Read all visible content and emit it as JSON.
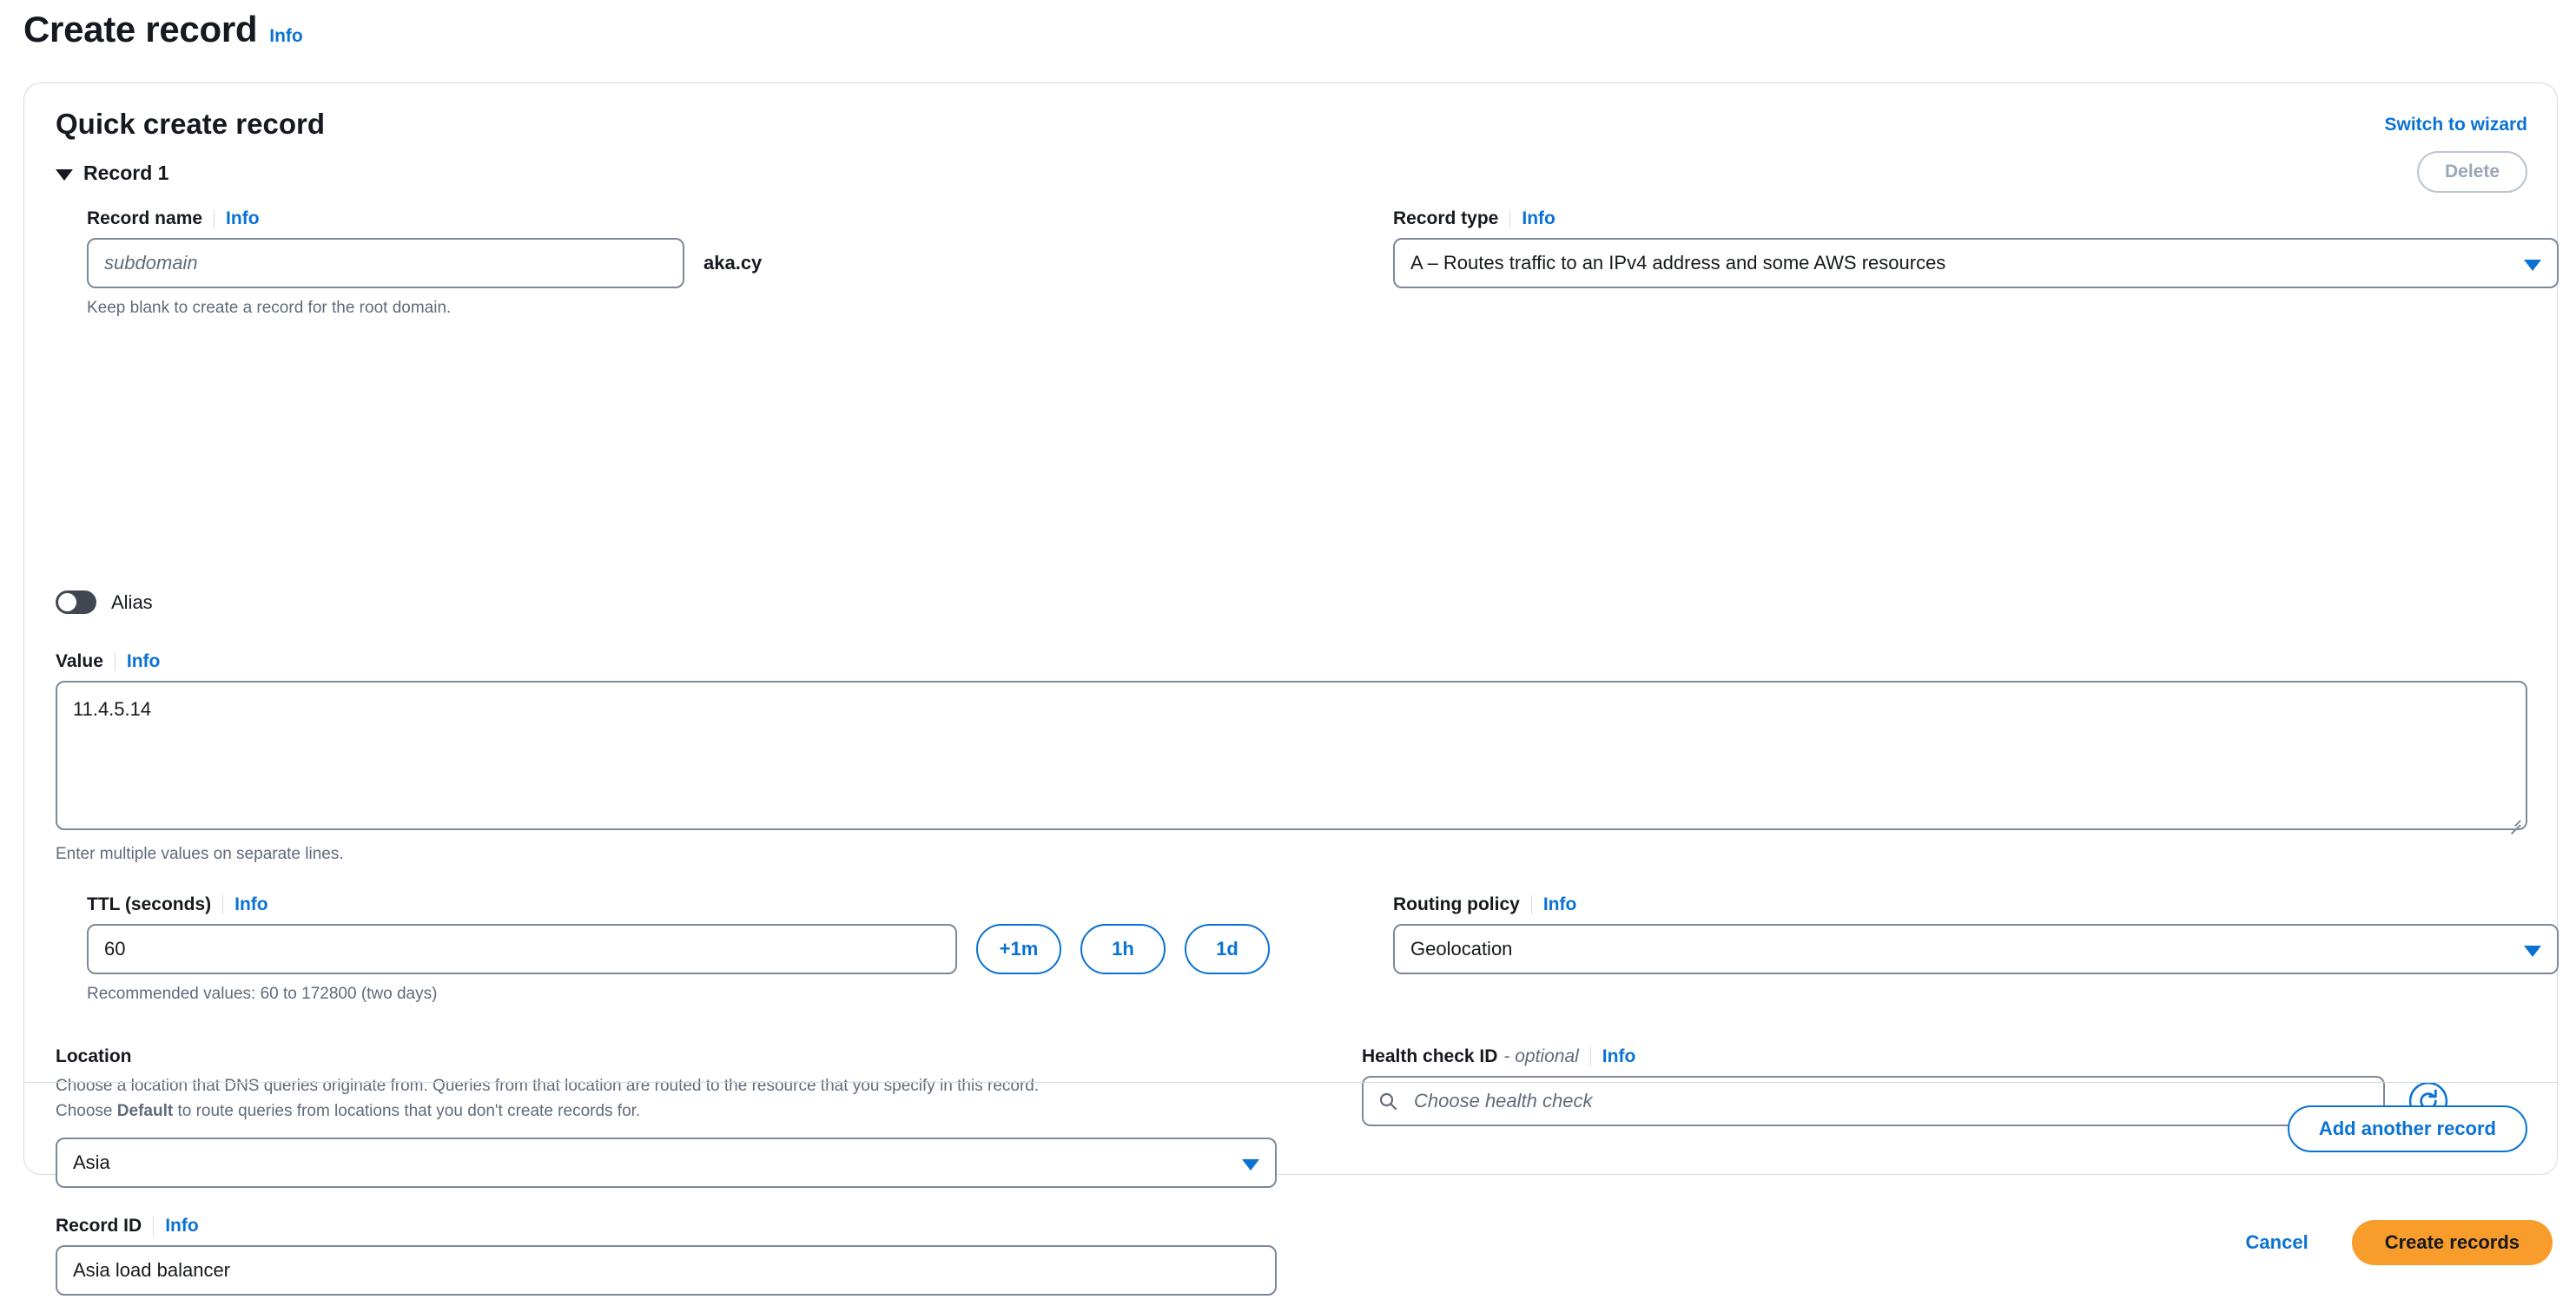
{
  "page": {
    "title": "Create record",
    "info_label": "Info"
  },
  "card": {
    "title": "Quick create record",
    "switch_link": "Switch to wizard",
    "record_label": "Record 1",
    "delete_label": "Delete",
    "add_another_label": "Add another record"
  },
  "fields": {
    "record_name": {
      "label": "Record name",
      "info": "Info",
      "value": "",
      "placeholder": "subdomain",
      "suffix": "aka.cy",
      "hint": "Keep blank to create a record for the root domain."
    },
    "record_type": {
      "label": "Record type",
      "info": "Info",
      "value": "A – Routes traffic to an IPv4 address and some AWS resources"
    },
    "alias": {
      "label": "Alias",
      "state": "off"
    },
    "value": {
      "label": "Value",
      "info": "Info",
      "value": "11.4.5.14",
      "hint": "Enter multiple values on separate lines."
    },
    "ttl": {
      "label": "TTL (seconds)",
      "info": "Info",
      "value": "60",
      "hint": "Recommended values: 60 to 172800 (two days)",
      "presets": [
        "+1m",
        "1h",
        "1d"
      ]
    },
    "routing_policy": {
      "label": "Routing policy",
      "info": "Info",
      "value": "Geolocation"
    },
    "location": {
      "label": "Location",
      "desc_line1": "Choose a location that DNS queries originate from. Queries from that location are routed to the resource that you specify in this record.",
      "desc_line2_pre": "Choose ",
      "desc_line2_bold": "Default",
      "desc_line2_post": " to route queries from locations that you don't create records for.",
      "value": "Asia"
    },
    "record_id": {
      "label": "Record ID",
      "info": "Info",
      "value": "Asia load balancer"
    },
    "health_check": {
      "label": "Health check ID",
      "optional": "- optional",
      "info": "Info",
      "value": "",
      "placeholder": "Choose health check"
    }
  },
  "actions": {
    "cancel_label": "Cancel",
    "create_label": "Create records"
  },
  "colors": {
    "link": "#0972d3",
    "primary": "#f89c2c",
    "border": "#7d8998",
    "toggle_off": "#414750"
  }
}
